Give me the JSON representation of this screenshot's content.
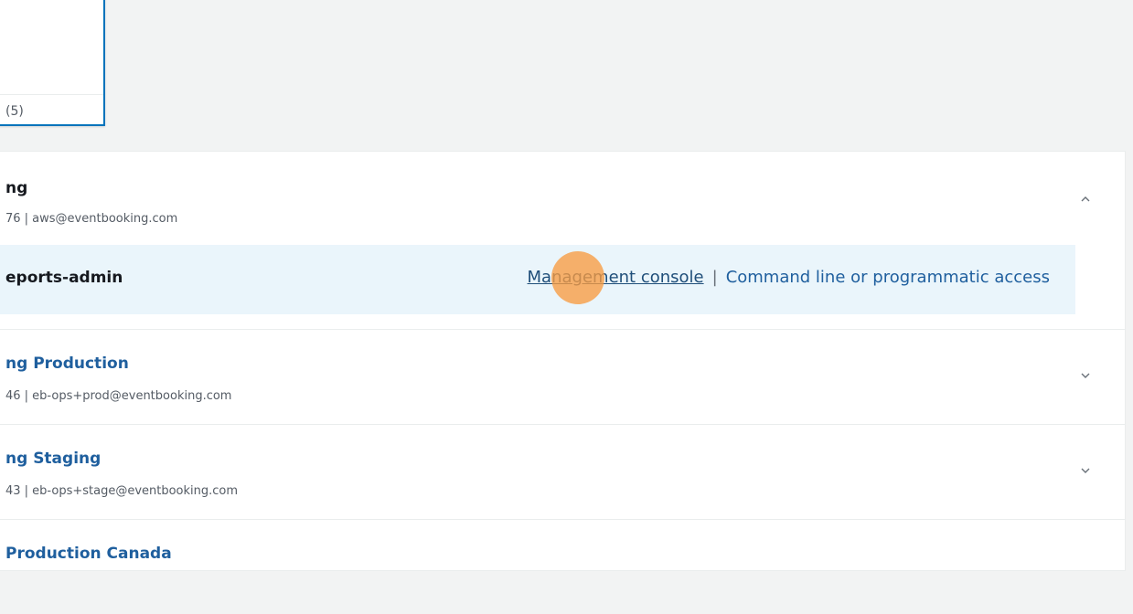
{
  "top_card": {
    "count_label": "(5)"
  },
  "accounts": [
    {
      "name": "ng",
      "meta": "76 | aws@eventbooking.com",
      "expanded": true,
      "chevron_icon": "chevron-up-icon",
      "role": {
        "name": "eports-admin",
        "management_console_label": "Management console",
        "separator": "|",
        "cli_label": "Command line or programmatic access"
      }
    },
    {
      "name": "ng Production",
      "meta": "46 | eb-ops+prod@eventbooking.com",
      "expanded": false,
      "chevron_icon": "chevron-down-icon"
    },
    {
      "name": "ng Staging",
      "meta": "43 | eb-ops+stage@eventbooking.com",
      "expanded": false,
      "chevron_icon": "chevron-down-icon"
    },
    {
      "name": "Production Canada",
      "partial": true
    }
  ],
  "colors": {
    "link": "#1f5f9e",
    "accent_border": "#0073bb",
    "role_row_bg": "#eaf5fb",
    "click_marker": "#f79b41"
  }
}
